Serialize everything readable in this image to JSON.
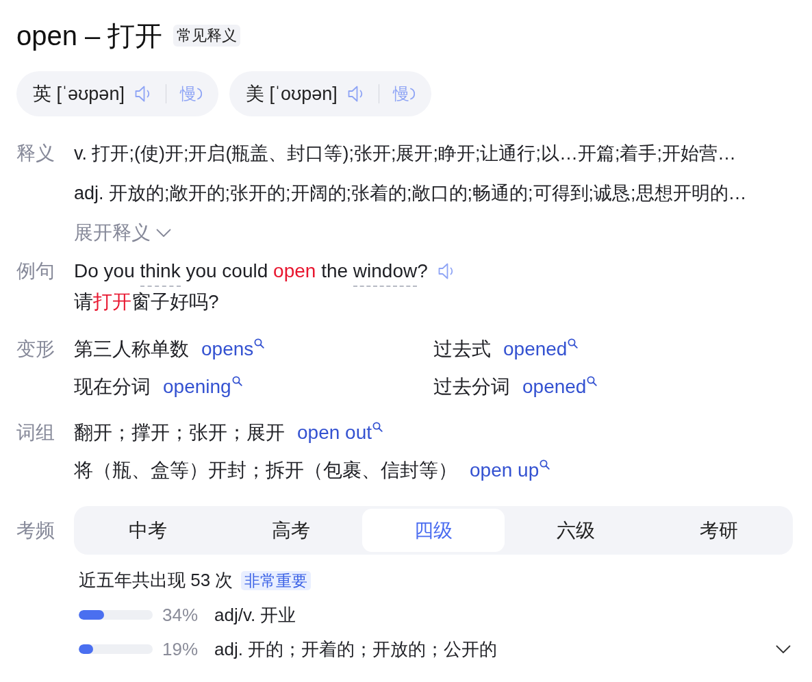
{
  "title": "open – 打开",
  "title_badge": "常见释义",
  "pronunciations": [
    {
      "region": "英",
      "ipa": "[ˈəʊpən]",
      "slow_label": "慢"
    },
    {
      "region": "美",
      "ipa": "[ˈoʊpən]",
      "slow_label": "慢"
    }
  ],
  "definitions": {
    "label": "释义",
    "lines": [
      "v. 打开;(使)开;开启(瓶盖、封口等);张开;展开;睁开;让通行;以…开篇;着手;开始营…",
      "adj. 开放的;敞开的;张开的;开阔的;张着的;敞口的;畅通的;可得到;诚恳;思想开明的…"
    ],
    "expand": "展开释义"
  },
  "example": {
    "label": "例句",
    "sentence": [
      {
        "kind": "plain",
        "text": "Do you "
      },
      {
        "kind": "lookup",
        "text": "think"
      },
      {
        "kind": "plain",
        "text": " you could "
      },
      {
        "kind": "highlight",
        "text": "open"
      },
      {
        "kind": "plain",
        "text": " the "
      },
      {
        "kind": "lookup",
        "text": "window"
      },
      {
        "kind": "plain",
        "text": "?"
      }
    ],
    "translation": [
      {
        "kind": "plain",
        "text": "请"
      },
      {
        "kind": "highlight",
        "text": "打开"
      },
      {
        "kind": "plain",
        "text": "窗子好吗?"
      }
    ]
  },
  "forms": {
    "label": "变形",
    "items": [
      {
        "name": "第三人称单数",
        "word": "opens"
      },
      {
        "name": "过去式",
        "word": "opened"
      },
      {
        "name": "现在分词",
        "word": "opening"
      },
      {
        "name": "过去分词",
        "word": "opened"
      }
    ]
  },
  "phrases": {
    "label": "词组",
    "items": [
      {
        "meaning": "翻开；撑开；张开；展开",
        "phrase": "open out"
      },
      {
        "meaning": "将（瓶、盒等）开封；拆开（包裹、信封等）",
        "phrase": "open up"
      }
    ]
  },
  "exam_frequency": {
    "label": "考频",
    "tabs": [
      {
        "label": "中考",
        "selected": false
      },
      {
        "label": "高考",
        "selected": false
      },
      {
        "label": "四级",
        "selected": true
      },
      {
        "label": "六级",
        "selected": false
      },
      {
        "label": "考研",
        "selected": false
      }
    ],
    "summary": "近五年共出现 53 次",
    "importance": "非常重要",
    "senses": [
      {
        "level": 0.34,
        "percent": "34%",
        "meaning": "adj/v. 开业"
      },
      {
        "level": 0.19,
        "percent": "19%",
        "meaning": "adj. 开的；开着的；开放的；公开的"
      }
    ]
  }
}
